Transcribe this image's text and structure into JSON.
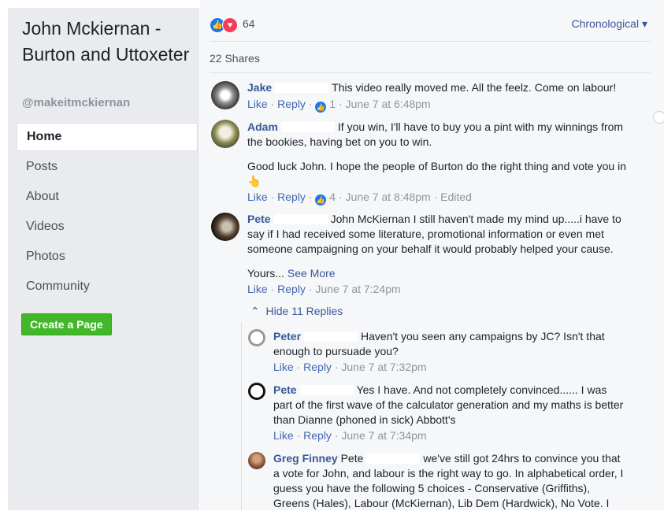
{
  "page": {
    "name": "John Mckiernan - Burton and Uttoxeter",
    "handle": "@makeitmckiernan",
    "nav": [
      "Home",
      "Posts",
      "About",
      "Videos",
      "Photos",
      "Community"
    ],
    "create_page_label": "Create a Page"
  },
  "post": {
    "reaction_count": "64",
    "sort_label": "Chronological",
    "shares": "22 Shares"
  },
  "comments": [
    {
      "author": "Jake",
      "text": "This video really moved me. All the feelz. Come on labour!",
      "like": "Like",
      "reply": "Reply",
      "likes": "1",
      "time": "June 7 at 6:48pm"
    },
    {
      "author": "Adam",
      "text": "If you win, I'll have to buy you a pint with my winnings from the bookies, having bet on you to win.",
      "text2": "Good luck John. I hope the people of Burton do the right thing and vote you in",
      "emoji": "👆",
      "like": "Like",
      "reply": "Reply",
      "likes": "4",
      "time": "June 7 at 8:48pm",
      "edited": "Edited"
    },
    {
      "author": "Pete",
      "text": "John McKiernan I still haven't made my mind up.....i have to say if I had received some literature, promotional information or even met someone campaigning on your behalf it would probably helped your cause.",
      "text2": "Yours...",
      "see_more": "See More",
      "like": "Like",
      "reply": "Reply",
      "time": "June 7 at 7:24pm"
    }
  ],
  "hide_replies": "Hide 11 Replies",
  "replies": [
    {
      "author": "Peter",
      "text": "Haven't you seen any campaigns by JC? Isn't that enough to pursuade you?",
      "like": "Like",
      "reply": "Reply",
      "time": "June 7 at 7:32pm"
    },
    {
      "author": "Pete",
      "text": "Yes I have. And not completely convinced...... I was part of the first wave of the calculator generation and my maths is better than Dianne (phoned in sick) Abbott's",
      "like": "Like",
      "reply": "Reply",
      "time": "June 7 at 7:34pm"
    },
    {
      "author": "Greg Finney",
      "mention": "Pete",
      "text": "we've still got 24hrs to convince you that a vote for John, and labour is the right way to go. In alphabetical order, I guess you have the following 5 choices - Conservative (Griffiths), Greens (Hales), Labour (McKiernan), Lib Dem (Hardwick), No Vote. I"
    }
  ],
  "colors": {
    "link": "#385898",
    "like_blue": "#1877f2",
    "love_red": "#f33e58",
    "create_green": "#42b72a"
  }
}
